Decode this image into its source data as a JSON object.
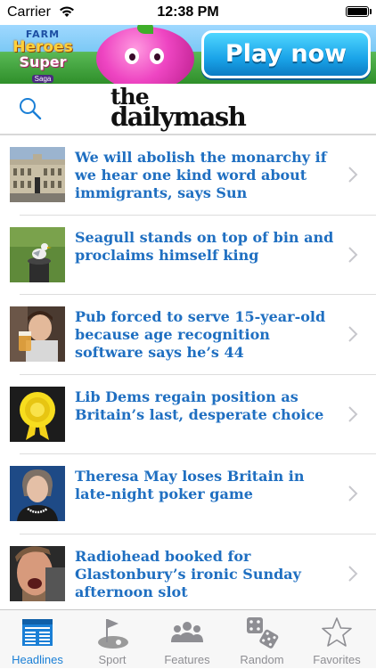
{
  "status_bar": {
    "carrier": "Carrier",
    "time": "12:38 PM",
    "battery_level": 1.0
  },
  "ad": {
    "game_line1": "FARM",
    "game_line2": "Heroes",
    "game_line3": "Super",
    "game_line4": "Saga",
    "cta_label": "Play now"
  },
  "header": {
    "search_icon": "search-icon",
    "logo_line1": "the",
    "logo_line2": "dailymash",
    "accent_color": "#1a7fd6"
  },
  "articles": [
    {
      "title": "We will abolish the monarchy if we hear one kind word about immigrants, says Sun",
      "image": "buckingham-palace"
    },
    {
      "title": "Seagull stands on top of bin and proclaims himself king",
      "image": "seagull-on-bin"
    },
    {
      "title": "Pub forced to serve 15-year-old because age recognition software says he’s 44",
      "image": "teen-with-pint"
    },
    {
      "title": "Lib Dems regain position as Britain’s last, desperate choice",
      "image": "yellow-rosette"
    },
    {
      "title": "Theresa May loses Britain in late-night poker game",
      "image": "theresa-may"
    },
    {
      "title": "Radiohead booked for Glastonbury’s ironic Sunday afternoon slot",
      "image": "thom-yorke"
    }
  ],
  "tab_bar": {
    "active": "Headlines",
    "tabs": [
      {
        "label": "Headlines",
        "icon": "newspaper-icon"
      },
      {
        "label": "Sport",
        "icon": "golf-flag-icon"
      },
      {
        "label": "Features",
        "icon": "people-icon"
      },
      {
        "label": "Random",
        "icon": "dice-icon"
      },
      {
        "label": "Favorites",
        "icon": "star-icon"
      }
    ]
  }
}
